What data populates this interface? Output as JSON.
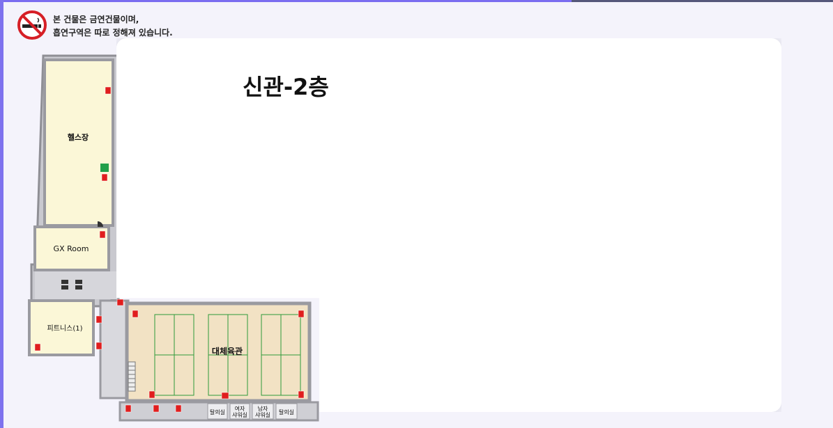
{
  "notice": {
    "line1": "본 건물은 금연건물이며,",
    "line2": "흡연구역은 따로 정해져 있습니다.",
    "icon": "no-smoking-icon"
  },
  "floor_title": "신관-2층",
  "rooms": {
    "health": "헬스장",
    "gx": "GX Room",
    "fitness": "피트니스(1)",
    "gym": "대체육관",
    "toilet1": "탈의실",
    "women_shower_1": "여자",
    "women_shower_2": "샤워실",
    "men_shower_1": "남자",
    "men_shower_2": "샤워실",
    "toilet2": "탈의실"
  },
  "colors": {
    "room_fill": "#fbf7d7",
    "gym_fill": "#f2e2c4",
    "wall": "#8f8f95",
    "extinguisher": "#e01e1e",
    "court_line": "#2f9a3a"
  }
}
